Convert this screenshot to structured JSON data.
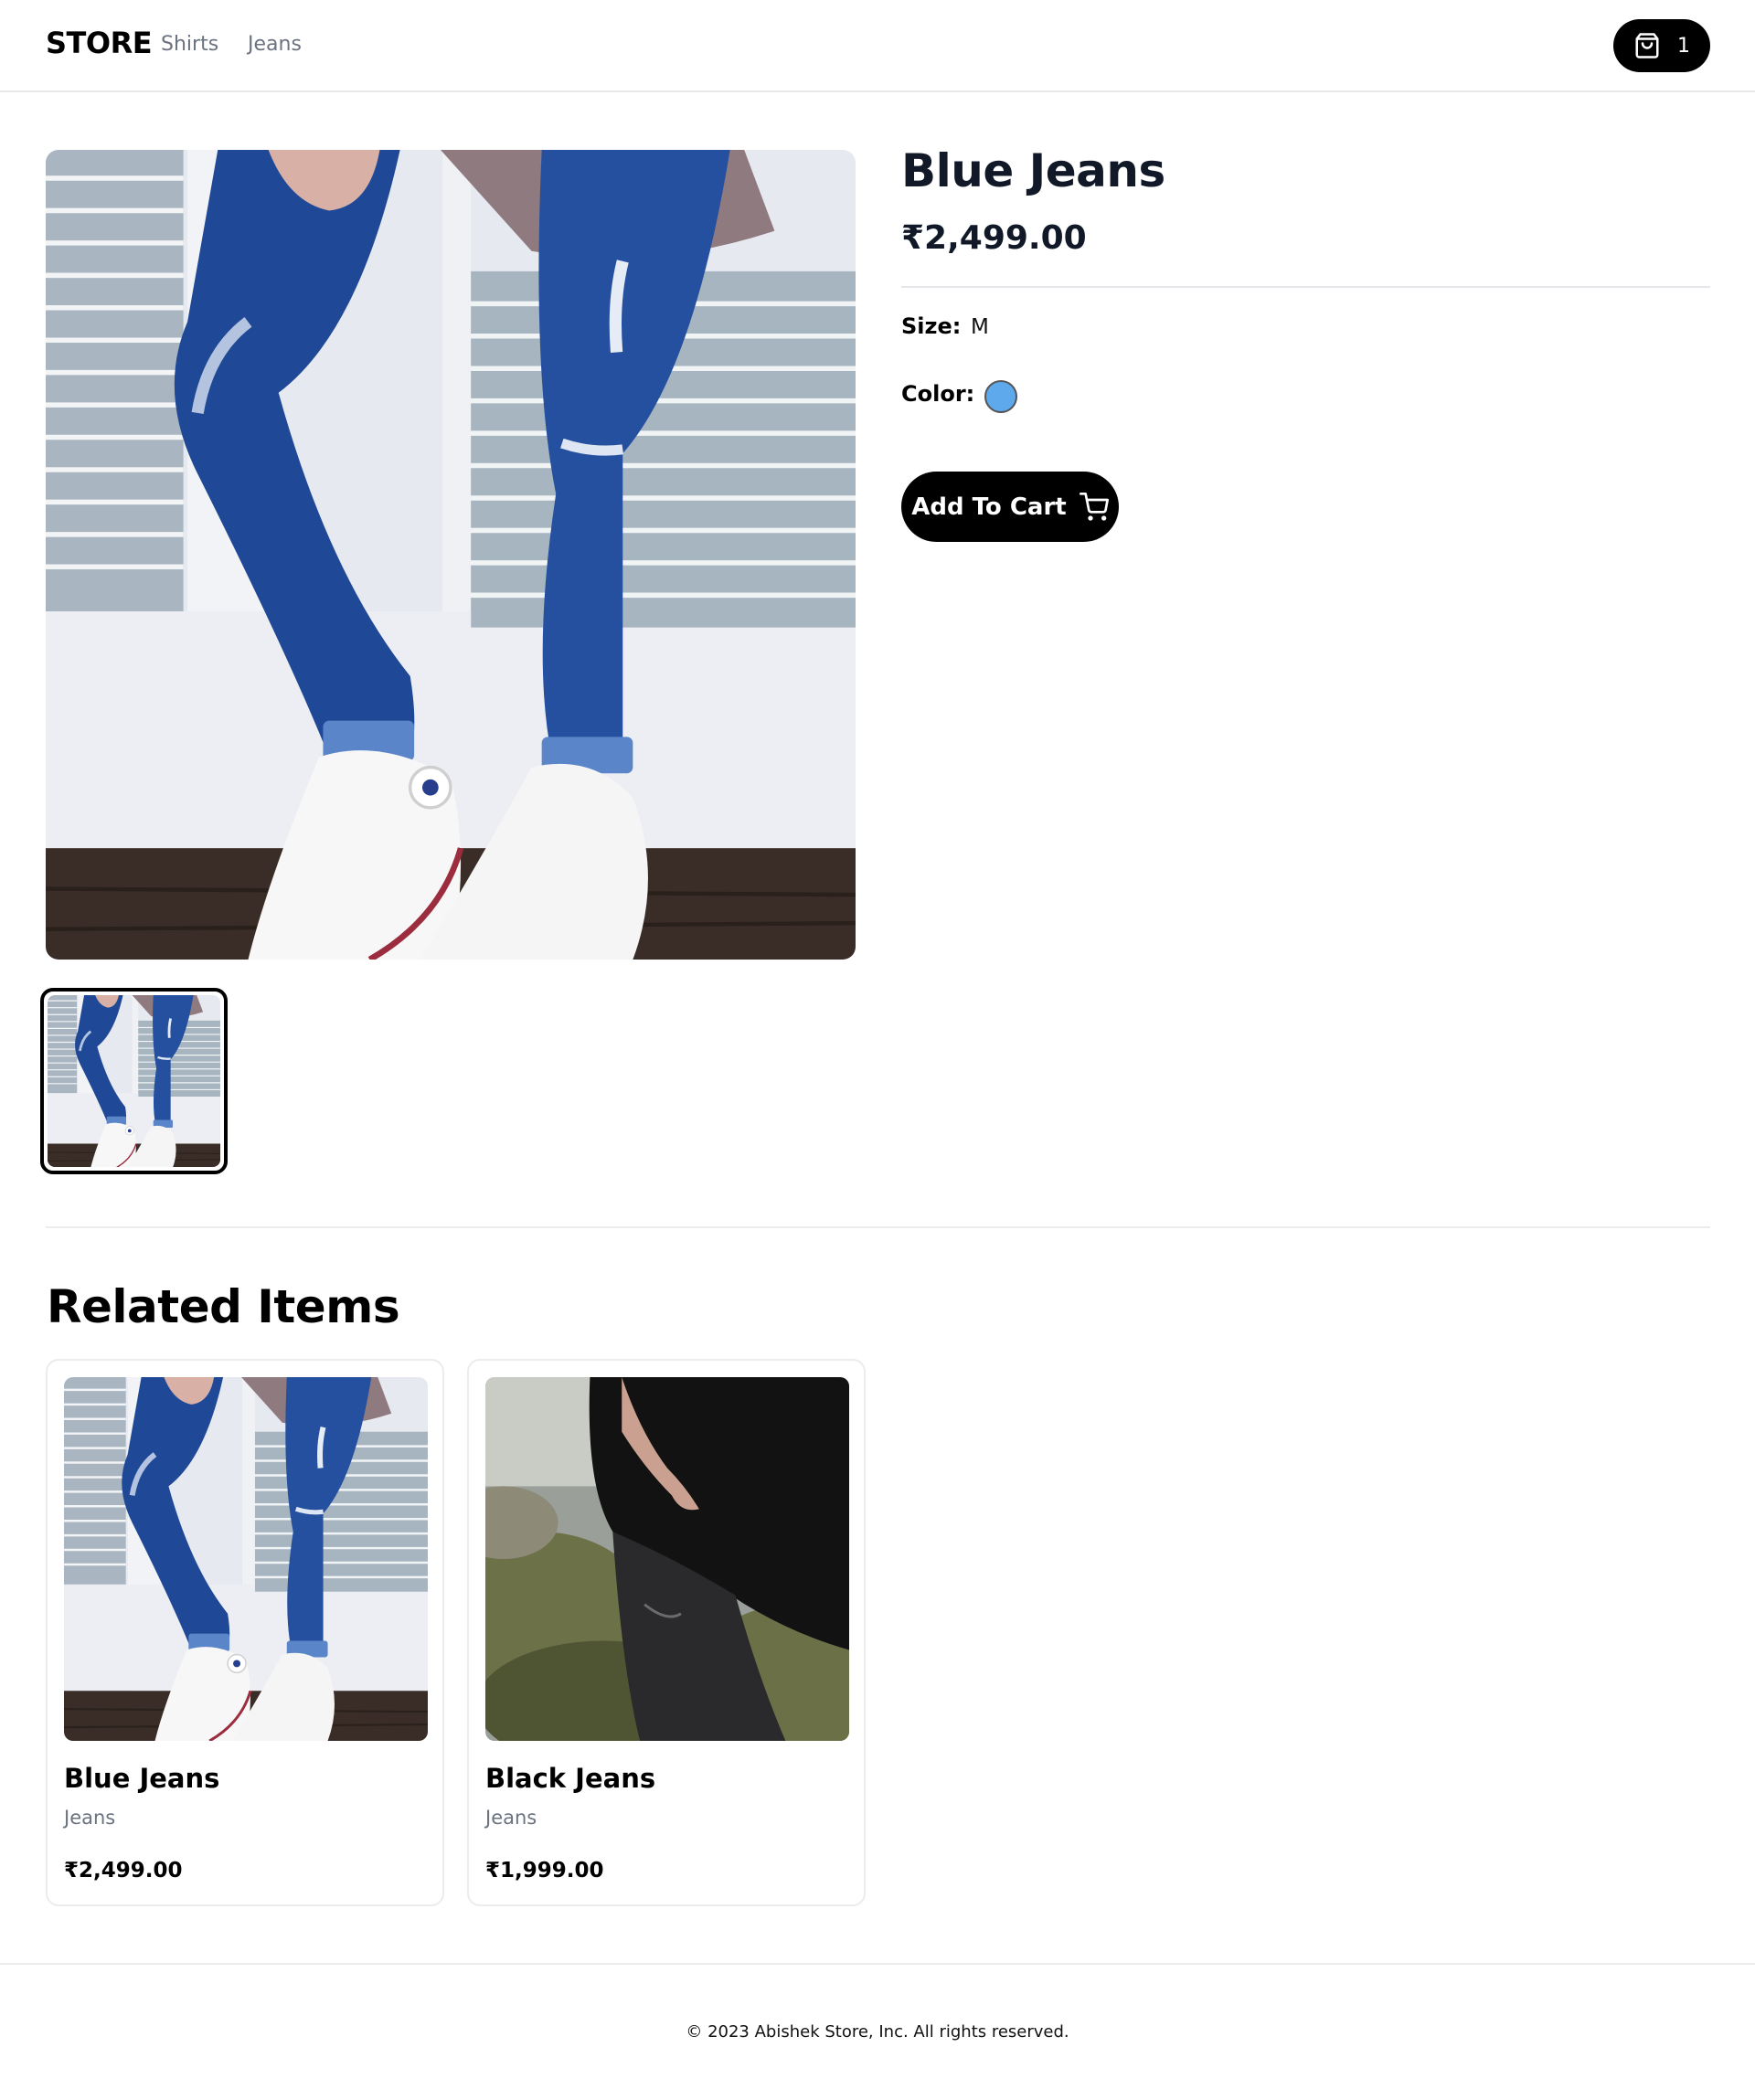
{
  "header": {
    "brand": "STORE",
    "nav": [
      "Shirts",
      "Jeans"
    ],
    "cart": {
      "icon": "shopping-bag-icon",
      "count": "1"
    }
  },
  "product": {
    "title": "Blue Jeans",
    "price": "₹2,499.00",
    "size_label": "Size:",
    "size_value": "M",
    "color_label": "Color:",
    "color_value": "#5ea8ec",
    "add_to_cart": "Add To Cart",
    "add_to_cart_icon": "shopping-cart-icon",
    "images": [
      "blue-jeans-photo"
    ]
  },
  "related": {
    "heading": "Related Items",
    "items": [
      {
        "name": "Blue Jeans",
        "category": "Jeans",
        "price": "₹2,499.00",
        "image": "blue-jeans-photo"
      },
      {
        "name": "Black Jeans",
        "category": "Jeans",
        "price": "₹1,999.00",
        "image": "black-jeans-photo"
      }
    ]
  },
  "footer": {
    "text": "© 2023 Abishek Store, Inc. All rights reserved."
  },
  "colors": {
    "accent": "#000000",
    "muted_text": "#6b7280",
    "border": "#ececee",
    "swatch": "#5ea8ec"
  }
}
